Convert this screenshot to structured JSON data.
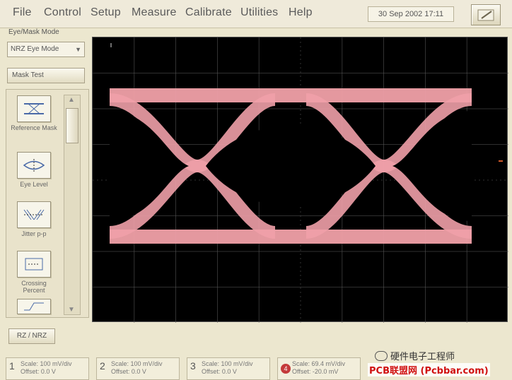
{
  "menu": {
    "items": [
      "File",
      "Control",
      "Setup",
      "Measure",
      "Calibrate",
      "Utilities",
      "Help"
    ],
    "datetime": "30 Sep 2002  17:11"
  },
  "left_panel": {
    "title": "Eye/Mask Mode",
    "mode_dropdown": "NRZ Eye Mode",
    "tab_label": "Mask Test",
    "mask_items": [
      {
        "icon": "mask-test-icon",
        "label": "Reference Mask"
      },
      {
        "icon": "eye-level-icon",
        "label": "Eye Level"
      },
      {
        "icon": "jitter-icon",
        "label": "Jitter p-p"
      },
      {
        "icon": "crossing-icon",
        "label": "Crossing Percent"
      },
      {
        "icon": "rise-time-icon",
        "label": ""
      }
    ],
    "nrz_button": "RZ / NRZ"
  },
  "channels": [
    {
      "num": "1",
      "scale": "Scale: 100 mV/div",
      "offset": "Offset: 0.0 V"
    },
    {
      "num": "2",
      "scale": "Scale: 100 mV/div",
      "offset": "Offset: 0.0 V"
    },
    {
      "num": "3",
      "scale": "Scale: 100 mV/div",
      "offset": "Offset: 0.0 V"
    },
    {
      "num": "4",
      "scale": "Scale: 69.4 mV/div",
      "offset": "Offset: -20.0 mV"
    }
  ],
  "watermark": {
    "top": "硬件电子工程师",
    "bottom": "PCB联盟网 (Pcbbar.com)"
  },
  "colors": {
    "trace": "#f0a0a8",
    "screen": "#000000",
    "grid": "#5a5a5a"
  }
}
